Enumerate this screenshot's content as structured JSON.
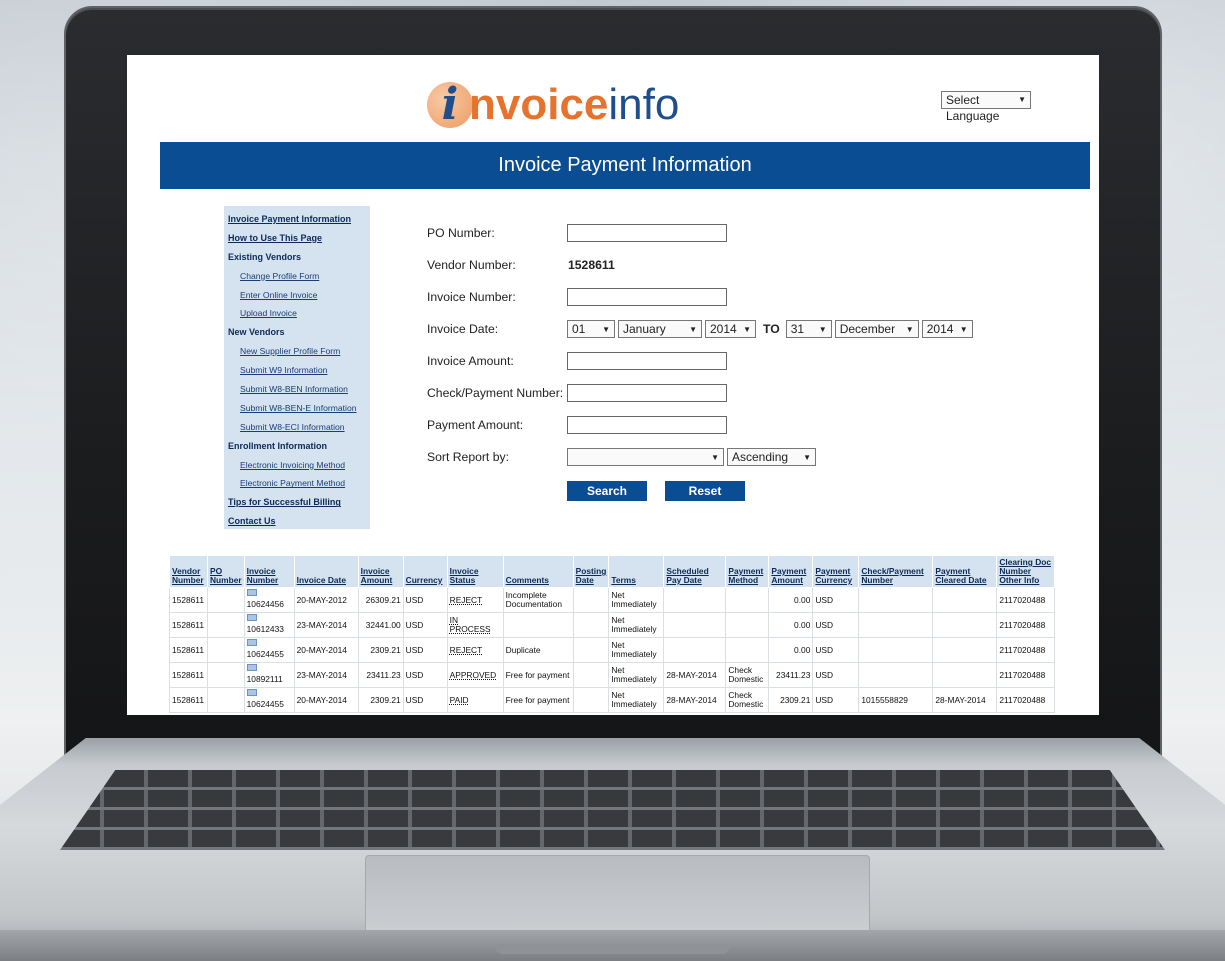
{
  "logo": {
    "i": "i",
    "bold": "nvoice",
    "light": "info"
  },
  "language_select": {
    "value": "Select Language"
  },
  "banner_title": "Invoice Payment Information",
  "sidebar": {
    "items": [
      {
        "label": "Invoice Payment Information",
        "kind": "top"
      },
      {
        "label": "How to Use This Page",
        "kind": "top"
      },
      {
        "label": "Existing Vendors",
        "kind": "head"
      },
      {
        "label": "Change Profile Form",
        "kind": "sub"
      },
      {
        "label": "Enter Online Invoice",
        "kind": "sub"
      },
      {
        "label": "Upload Invoice",
        "kind": "sub"
      },
      {
        "label": "New Vendors",
        "kind": "head"
      },
      {
        "label": "New Supplier Profile Form",
        "kind": "sub"
      },
      {
        "label": "Submit W9 Information",
        "kind": "sub"
      },
      {
        "label": "Submit W8-BEN Information",
        "kind": "sub"
      },
      {
        "label": "Submit W8-BEN-E Information",
        "kind": "sub"
      },
      {
        "label": "Submit W8-ECI Information",
        "kind": "sub"
      },
      {
        "label": "Enrollment Information",
        "kind": "head"
      },
      {
        "label": "Electronic Invoicing Method",
        "kind": "sub"
      },
      {
        "label": "Electronic Payment Method",
        "kind": "sub"
      },
      {
        "label": "Tips for Successful Billing",
        "kind": "top"
      },
      {
        "label": "Contact Us",
        "kind": "top"
      }
    ]
  },
  "form": {
    "po_number_label": "PO Number:",
    "po_number_value": "",
    "vendor_number_label": "Vendor Number:",
    "vendor_number_value": "1528611",
    "invoice_number_label": "Invoice Number:",
    "invoice_number_value": "",
    "invoice_date_label": "Invoice Date:",
    "from_day": "01",
    "from_month": "January",
    "from_year": "2014",
    "to_label": "TO",
    "to_day": "31",
    "to_month": "December",
    "to_year": "2014",
    "invoice_amount_label": "Invoice Amount:",
    "invoice_amount_value": "",
    "check_payment_label": "Check/Payment Number:",
    "check_payment_value": "",
    "payment_amount_label": "Payment Amount:",
    "payment_amount_value": "",
    "sort_label": "Sort Report by:",
    "sort_value": "",
    "sort_order": "Ascending",
    "search_label": "Search",
    "reset_label": "Reset"
  },
  "table": {
    "headers": [
      "Vendor Number",
      "PO Number",
      "Invoice Number",
      "Invoice Date",
      "Invoice Amount",
      "Currency",
      "Invoice Status",
      "Comments",
      "Posting Date",
      "Terms",
      "Scheduled Pay Date",
      "Payment Method",
      "Payment Amount",
      "Payment Currency",
      "Check/Payment Number",
      "Payment Cleared Date",
      "Clearing Doc Number Other Info"
    ],
    "rows": [
      [
        "1528611",
        "",
        "10624456",
        "20-MAY-2012",
        "26309.21",
        "USD",
        "REJECT",
        "Incomplete Documentation",
        "",
        "Net Immediately",
        "",
        "",
        "0.00",
        "USD",
        "",
        "",
        "2117020488"
      ],
      [
        "1528611",
        "",
        "10612433",
        "23-MAY-2014",
        "32441.00",
        "USD",
        "IN PROCESS",
        "",
        "",
        "Net Immediately",
        "",
        "",
        "0.00",
        "USD",
        "",
        "",
        "2117020488"
      ],
      [
        "1528611",
        "",
        "10624455",
        "20-MAY-2014",
        "2309.21",
        "USD",
        "REJECT",
        "Duplicate",
        "",
        "Net Immediately",
        "",
        "",
        "0.00",
        "USD",
        "",
        "",
        "2117020488"
      ],
      [
        "1528611",
        "",
        "10892111",
        "23-MAY-2014",
        "23411.23",
        "USD",
        "APPROVED",
        "Free for payment",
        "",
        "Net Immediately",
        "28-MAY-2014",
        "Check Domestic",
        "23411.23",
        "USD",
        "",
        "",
        "2117020488"
      ],
      [
        "1528611",
        "",
        "10624455",
        "20-MAY-2014",
        "2309.21",
        "USD",
        "PAID",
        "Free for payment",
        "",
        "Net Immediately",
        "28-MAY-2014",
        "Check Domestic",
        "2309.21",
        "USD",
        "1015558829",
        "28-MAY-2014",
        "2117020488"
      ]
    ]
  }
}
